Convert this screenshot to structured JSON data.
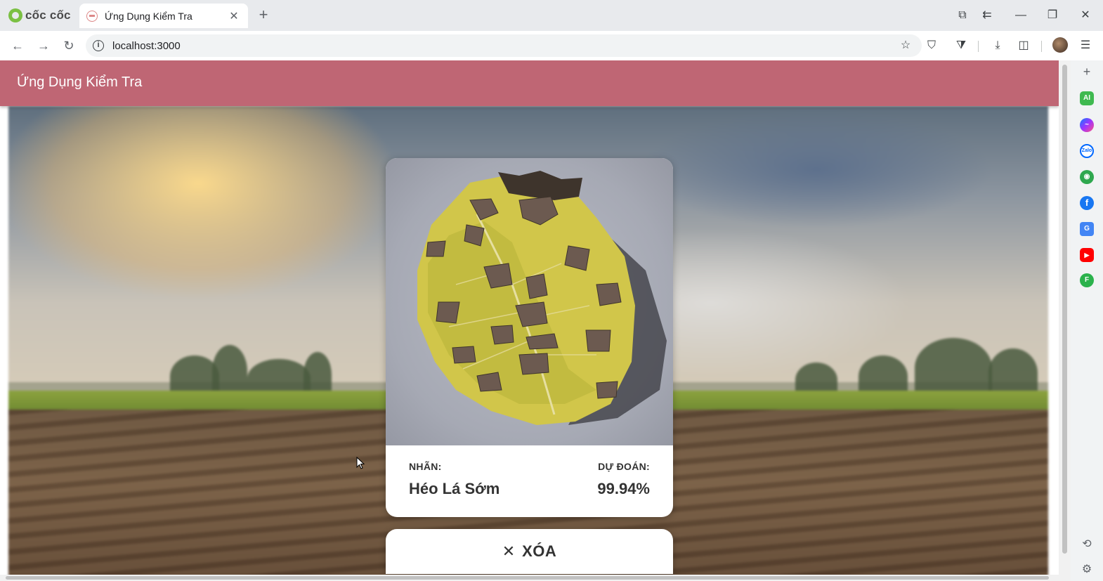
{
  "browser": {
    "brand": "cốc cốc",
    "tab_title": "Ứng Dụng Kiểm Tra",
    "url": "localhost:3000"
  },
  "app": {
    "title": "Ứng Dụng Kiểm Tra"
  },
  "result": {
    "label_heading": "NHÃN:",
    "label_value": "Héo Lá Sớm",
    "prediction_heading": "DỰ ĐOÁN:",
    "prediction_value": "99.94%"
  },
  "actions": {
    "clear_label": "XÓA"
  },
  "colors": {
    "appbar": "#bf6674",
    "card": "#ffffff",
    "text": "#333333"
  },
  "sidebar_icons": [
    "add-icon",
    "ai-icon",
    "messenger-icon",
    "zalo-icon",
    "game-icon",
    "facebook-icon",
    "translate-icon",
    "youtube-icon",
    "feedly-icon",
    "history-icon",
    "settings-icon"
  ]
}
